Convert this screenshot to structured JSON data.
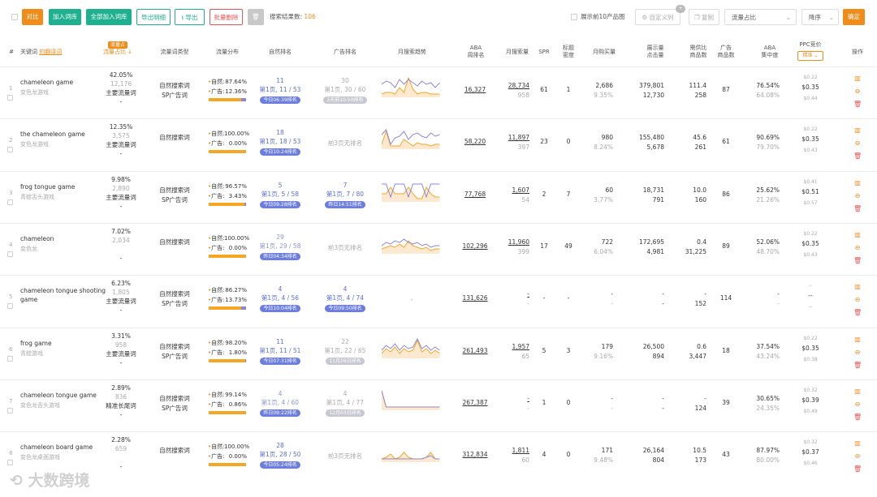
{
  "toolbar": {
    "compare": "对比",
    "add_to_lib": "加入词库",
    "add_all_to_lib": "全部加入词库",
    "export_detail": "导出明细",
    "export": "导出",
    "batch_delete": "批量删除",
    "result_label": "搜索结果数:",
    "result_count": "106",
    "show_top10": "展示前10产品图",
    "custom_cols": "自定义列",
    "custom_badge": "+",
    "copy": "复制",
    "sort_field": "流量占比",
    "sort_order": "降序",
    "confirm": "确定"
  },
  "header": {
    "idx": "#",
    "keyword": "关键词",
    "keyword_link": "的翻译词",
    "traffic_ratio_tag": "流量占",
    "traffic_ratio": "流量占比 ↓",
    "traffic_type": "流量词类型",
    "traffic_dist": "流量分布",
    "organic_rank": "自然排名",
    "ad_rank": "广告排名",
    "monthly_trend": "月搜索趋势",
    "aba_rank": [
      "ABA",
      "周排名"
    ],
    "monthly_search": "月搜索量",
    "spr": "SPR",
    "title_density": [
      "标题",
      "密度"
    ],
    "monthly_buy": "月购买量",
    "impressions": [
      "展示量",
      "点击量"
    ],
    "supply_ratio": [
      "需供比",
      "商品数"
    ],
    "ad_products": [
      "广告",
      "商品数"
    ],
    "aba_concentration": [
      "ABA",
      "集中度"
    ],
    "ppc": "PPC竞价",
    "ppc_btn": "精准 ⌄",
    "actions": "操作"
  },
  "rows": [
    {
      "idx": "1",
      "kw": "chameleon game",
      "kw_cn": "变色龙游戏",
      "ratio": "42.05%",
      "ratio_sub": "12,176",
      "ratio_type": "主要流量词",
      "ratio_dash": "-",
      "type1": "自然搜索词",
      "type2": "SP广告词",
      "nat_label": "自然:",
      "nat": "87.64%",
      "ad_label": "广告:",
      "ad": "12.36%",
      "nat_frac": 0.8764,
      "org1": "11",
      "org2": "第1页, 11 / 53",
      "org_badge": "今日06:39排名",
      "org_faded": false,
      "ad1": "30",
      "ad2": "第1页, 30 / 60",
      "ad_badge": "2天前10:50排名",
      "ad_faded": true,
      "ad_none": "",
      "aba": "16,327",
      "ms1": "28,734",
      "ms2": "958",
      "spr": "61",
      "td": "1",
      "mb1": "2,686",
      "mb2": "9.35%",
      "imp1": "379,801",
      "imp2": "12,730",
      "sr1": "111.4",
      "sr2": "258",
      "adp": "87",
      "abac1": "76.54%",
      "abac2": "64.08%",
      "ppc1": "$0.22",
      "ppc2": "$0.35",
      "ppc3": "$0.44",
      "spark": "a"
    },
    {
      "idx": "2",
      "kw": "the chameleon game",
      "kw_cn": "变色龙游戏",
      "ratio": "12.35%",
      "ratio_sub": "3,575",
      "ratio_type": "主要流量词",
      "ratio_dash": "-",
      "type1": "自然搜索词",
      "type2": "",
      "nat_label": "自然:",
      "nat": "100.00%",
      "ad_label": "广告:",
      "ad": "0.00%",
      "nat_frac": 1.0,
      "org1": "18",
      "org2": "第1页, 18 / 53",
      "org_badge": "今日10:24排名",
      "org_faded": false,
      "ad1": "",
      "ad2": "",
      "ad_badge": "",
      "ad_faded": false,
      "ad_none": "前3页无排名",
      "aba": "58,220",
      "ms1": "11,897",
      "ms2": "397",
      "spr": "23",
      "td": "0",
      "mb1": "980",
      "mb2": "8.24%",
      "imp1": "155,480",
      "imp2": "5,678",
      "sr1": "45.6",
      "sr2": "261",
      "adp": "61",
      "abac1": "90.69%",
      "abac2": "79.70%",
      "ppc1": "$0.22",
      "ppc2": "$0.35",
      "ppc3": "$0.43",
      "spark": "b"
    },
    {
      "idx": "3",
      "kw": "frog tongue game",
      "kw_cn": "青蛙舌头游戏",
      "ratio": "9.98%",
      "ratio_sub": "2,890",
      "ratio_type": "主要流量词",
      "ratio_dash": "-",
      "type1": "自然搜索词",
      "type2": "SP广告词",
      "nat_label": "自然:",
      "nat": "96.57%",
      "ad_label": "广告:",
      "ad": "3.43%",
      "nat_frac": 0.9657,
      "org1": "5",
      "org2": "第1页, 5 / 58",
      "org_badge": "今日09:28排名",
      "org_faded": false,
      "ad1": "7",
      "ad2": "第1页, 7 / 80",
      "ad_badge": "昨日14:51排名",
      "ad_faded": false,
      "ad_none": "",
      "aba": "77,768",
      "ms1": "1,607",
      "ms2": "54",
      "spr": "2",
      "td": "7",
      "mb1": "60",
      "mb2": "3.77%",
      "imp1": "18,731",
      "imp2": "791",
      "sr1": "10.0",
      "sr2": "160",
      "adp": "86",
      "abac1": "25.62%",
      "abac2": "21.26%",
      "ppc1": "$0.41",
      "ppc2": "$0.51",
      "ppc3": "$0.57",
      "spark": "c"
    },
    {
      "idx": "4",
      "kw": "chameleon",
      "kw_cn": "变色龙",
      "ratio": "7.02%",
      "ratio_sub": "2,034",
      "ratio_type": "",
      "ratio_dash": "-",
      "type1": "自然搜索词",
      "type2": "",
      "nat_label": "自然:",
      "nat": "100.00%",
      "ad_label": "广告:",
      "ad": "0.00%",
      "nat_frac": 1.0,
      "org1": "29",
      "org2": "第1页, 29 / 58",
      "org_badge": "昨日04:34排名",
      "org_faded": true,
      "ad1": "",
      "ad2": "",
      "ad_badge": "",
      "ad_faded": false,
      "ad_none": "前3页无排名",
      "aba": "102,296",
      "ms1": "11,960",
      "ms2": "399",
      "spr": "17",
      "td": "49",
      "mb1": "722",
      "mb2": "6.04%",
      "imp1": "172,695",
      "imp2": "4,981",
      "sr1": "0.4",
      "sr2": "31,225",
      "adp": "89",
      "abac1": "52.06%",
      "abac2": "48.70%",
      "ppc1": "$0.22",
      "ppc2": "$0.35",
      "ppc3": "$0.43",
      "spark": "d"
    },
    {
      "idx": "5",
      "kw": "chameleon tongue shooting",
      "kw2": "game",
      "kw_cn": "",
      "ratio": "6.23%",
      "ratio_sub": "1,805",
      "ratio_type": "主要流量词",
      "ratio_dash": "-",
      "type1": "自然搜索词",
      "type2": "SP广告词",
      "nat_label": "自然:",
      "nat": "86.27%",
      "ad_label": "广告:",
      "ad": "13.73%",
      "nat_frac": 0.8627,
      "org1": "4",
      "org2": "第1页, 4 / 56",
      "org_badge": "今日10:04排名",
      "org_faded": false,
      "ad1": "4",
      "ad2": "第1页, 4 / 74",
      "ad_badge": "今日09:50排名",
      "ad_faded": false,
      "ad_none": "",
      "aba": "131,626",
      "ms1": "-",
      "ms2": "-",
      "spr": "-",
      "td": "-",
      "mb1": "-",
      "mb2": "-",
      "imp1": "-",
      "imp2": "-",
      "sr1": "-",
      "sr2": "152",
      "adp": "114",
      "abac1": "-",
      "abac2": "-",
      "ppc1": "--",
      "ppc2": "--",
      "ppc3": "--",
      "spark": "none",
      "spark_none": "-"
    },
    {
      "idx": "6",
      "kw": "frog game",
      "kw_cn": "青蛙游戏",
      "ratio": "3.31%",
      "ratio_sub": "958",
      "ratio_type": "主要流量词",
      "ratio_dash": "-",
      "type1": "自然搜索词",
      "type2": "SP广告词",
      "nat_label": "自然:",
      "nat": "98.20%",
      "ad_label": "广告:",
      "ad": "1.80%",
      "nat_frac": 0.982,
      "org1": "11",
      "org2": "第1页, 11 / 51",
      "org_badge": "今日07:31排名",
      "org_faded": false,
      "ad1": "22",
      "ad2": "第1页, 22 / 65",
      "ad_badge": "11月26日排名",
      "ad_faded": true,
      "ad_none": "",
      "aba": "261,493",
      "ms1": "1,957",
      "ms2": "65",
      "spr": "5",
      "td": "3",
      "mb1": "179",
      "mb2": "9.16%",
      "imp1": "26,500",
      "imp2": "894",
      "sr1": "0.6",
      "sr2": "3,447",
      "adp": "18",
      "abac1": "37.54%",
      "abac2": "43.24%",
      "ppc1": "$0.22",
      "ppc2": "$0.35",
      "ppc3": "$0.38",
      "spark": "e"
    },
    {
      "idx": "7",
      "kw": "chameleon tongue game",
      "kw_cn": "变色龙舌头游戏",
      "ratio": "2.89%",
      "ratio_sub": "836",
      "ratio_type": "精准长尾词",
      "ratio_dash": "-",
      "type1": "自然搜索词",
      "type2": "SP广告词",
      "nat_label": "自然:",
      "nat": "99.14%",
      "ad_label": "广告:",
      "ad": "0.86%",
      "nat_frac": 0.9914,
      "org1": "4",
      "org2": "第1页, 4 / 60",
      "org_badge": "昨日09:22排名",
      "org_faded": true,
      "ad1": "4",
      "ad2": "第1页, 4 / 77",
      "ad_badge": "12月03日排名",
      "ad_faded": true,
      "ad_none": "",
      "aba": "267,387",
      "ms1": "-",
      "ms2": "-",
      "spr": "1",
      "td": "0",
      "mb1": "-",
      "mb2": "-",
      "imp1": "-",
      "imp2": "-",
      "sr1": "-",
      "sr2": "124",
      "adp": "39",
      "abac1": "30.65%",
      "abac2": "24.35%",
      "ppc1": "$0.32",
      "ppc2": "$0.39",
      "ppc3": "$0.49",
      "spark": "f"
    },
    {
      "idx": "8",
      "kw": "chameleon board game",
      "kw_cn": "变色龙桌面游戏",
      "ratio": "2.28%",
      "ratio_sub": "659",
      "ratio_type": "",
      "ratio_dash": "-",
      "type1": "自然搜索词",
      "type2": "",
      "nat_label": "自然:",
      "nat": "100.00%",
      "ad_label": "广告:",
      "ad": "0.00%",
      "nat_frac": 1.0,
      "org1": "28",
      "org2": "第1页, 28 / 50",
      "org_badge": "今日05:24排名",
      "org_faded": false,
      "ad1": "",
      "ad2": "",
      "ad_badge": "",
      "ad_faded": false,
      "ad_none": "前3页无排名",
      "aba": "312,834",
      "ms1": "1,811",
      "ms2": "60",
      "spr": "4",
      "td": "0",
      "mb1": "171",
      "mb2": "9.48%",
      "imp1": "26,164",
      "imp2": "804",
      "sr1": "10.5",
      "sr2": "173",
      "adp": "43",
      "abac1": "87.97%",
      "abac2": "80.00%",
      "ppc1": "$0.32",
      "ppc2": "$0.37",
      "ppc3": "$0.46",
      "spark": "g"
    }
  ],
  "watermark": "大数跨境",
  "colors": {
    "accent": "#f08c1a",
    "green": "#1fb08f",
    "blue": "#6b7ee0",
    "red": "#e45656"
  }
}
